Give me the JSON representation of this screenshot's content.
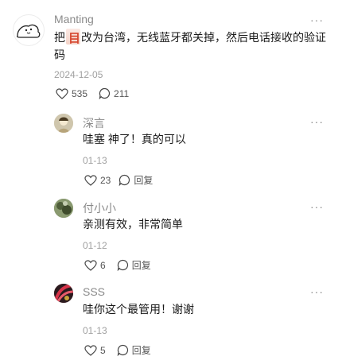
{
  "main_comment": {
    "author": "Manting",
    "text_before": "把",
    "sticker_char": "目",
    "text_after": "改为台湾，无线蓝牙都关掉，然后电话接收的验证码",
    "date": "2024-12-05",
    "likes": "535",
    "replies": "211",
    "more": "···"
  },
  "replies": [
    {
      "author": "深言",
      "text": "哇塞 神了！真的可以",
      "date": "01-13",
      "likes": "23",
      "reply_label": "回复",
      "more": "···"
    },
    {
      "author": "付小小",
      "text": "亲测有效，非常简单",
      "date": "01-12",
      "likes": "6",
      "reply_label": "回复",
      "more": "···"
    },
    {
      "author": "SSS",
      "text": "哇你这个最管用！谢谢",
      "date": "01-13",
      "likes": "5",
      "reply_label": "回复",
      "more": "···"
    }
  ],
  "colors": {
    "text": "#1a1a1a",
    "meta": "#a0a0a0",
    "name": "#8a8a8a"
  }
}
